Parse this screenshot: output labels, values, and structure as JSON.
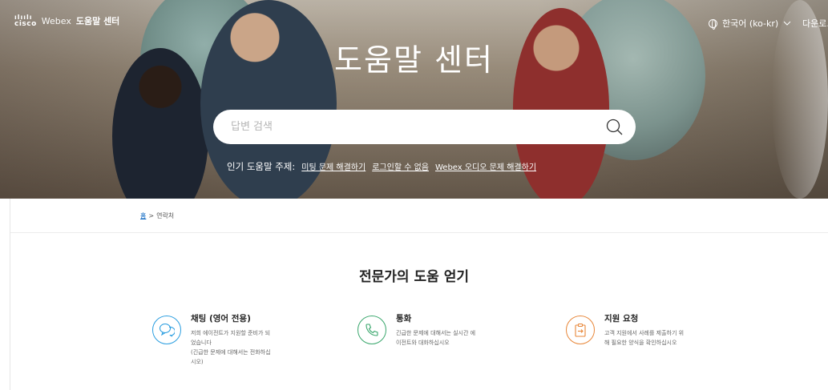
{
  "header": {
    "brand_mark": "cisco",
    "brand_product": "Webex",
    "brand_title": "도움말 센터",
    "language": "한국어 (ko-kr)",
    "download": "다운로."
  },
  "hero": {
    "title": "도움말 센터",
    "search_placeholder": "답변 검색",
    "popular_label": "인기 도움말 주제:",
    "popular_links": [
      "미팅 문제 해결하기",
      "로그인할 수 없음",
      "Webex 오디오 문제 해결하기"
    ]
  },
  "breadcrumb": {
    "home": "홈",
    "separator": ">",
    "current": "연락처"
  },
  "section": {
    "title": "전문가의 도움 얻기"
  },
  "cards": [
    {
      "title": "채팅 (영어 전용)",
      "lines": [
        "저희 에이전트가 지원할 준비가 되",
        "었습니다",
        "(긴급한 문제에 대해서는 전화하십",
        "시오)"
      ],
      "icon": "chat-bubbles-icon",
      "color": "#2b9ee0"
    },
    {
      "title": "통화",
      "lines": [
        "긴급한 문제에 대해서는 실시간 에",
        "이전트와 대화하십시오"
      ],
      "icon": "phone-icon",
      "color": "#3aa76d"
    },
    {
      "title": "지원 요청",
      "lines": [
        "고객 지원에서 사례를 제출하기 위",
        "해 필요한 양식을 확인하십시오"
      ],
      "icon": "clipboard-arrow-icon",
      "color": "#e8873a"
    }
  ]
}
